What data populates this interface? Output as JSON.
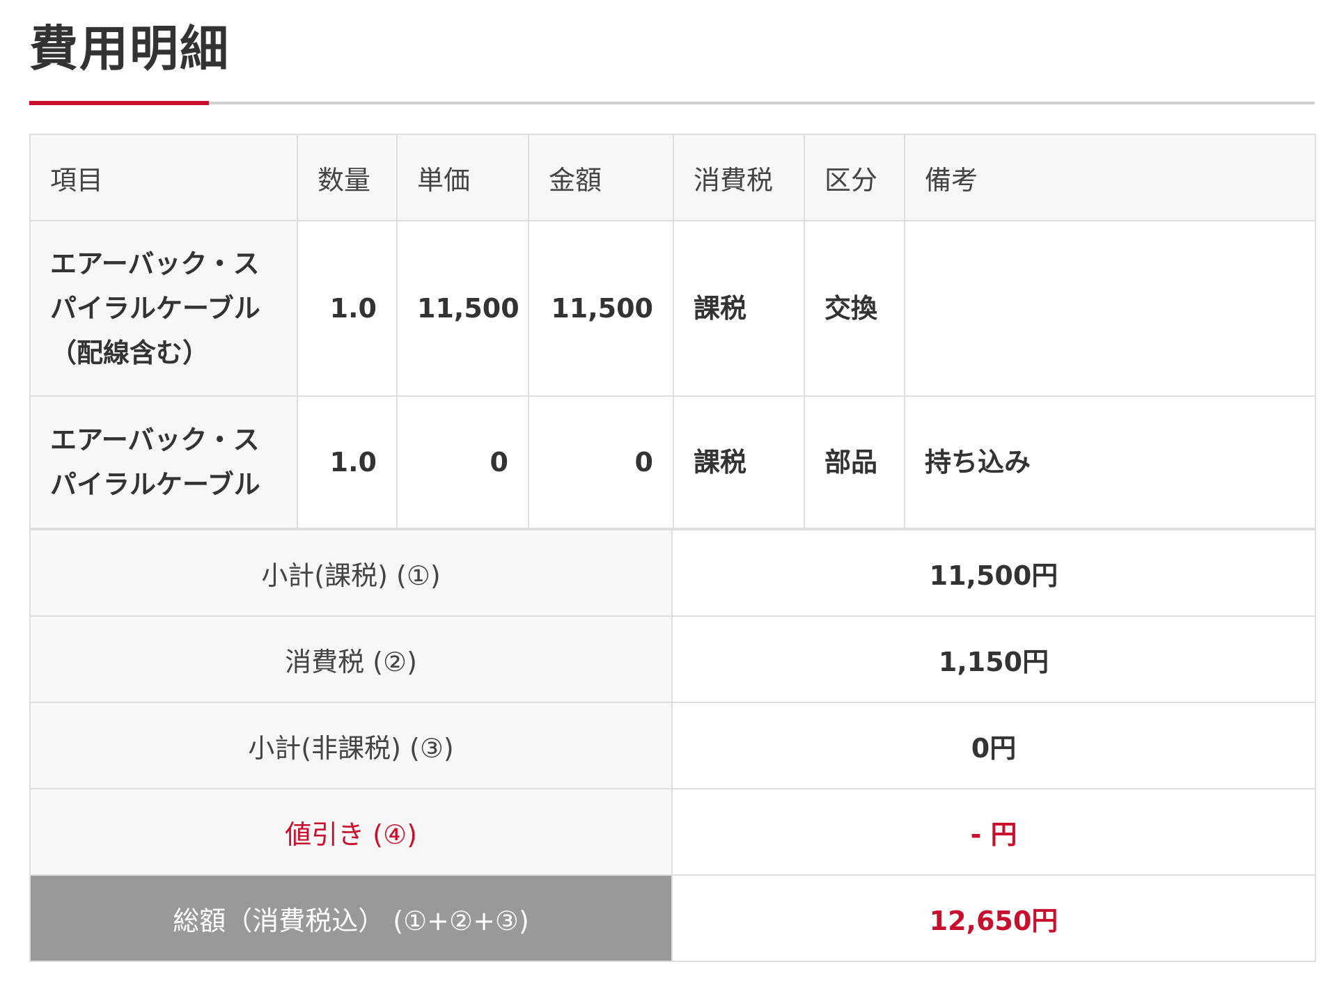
{
  "title": "費用明細",
  "colors": {
    "accent": "#c8102e",
    "header_bg": "#f7f7f7",
    "total_bg": "#999999"
  },
  "table": {
    "headers": [
      "項目",
      "数量",
      "単価",
      "金額",
      "消費税",
      "区分",
      "備考"
    ],
    "rows": [
      {
        "item_lines": [
          "エアーバック・ス",
          "パイラルケーブル",
          "（配線含む）"
        ],
        "quantity": "1.0",
        "unit_price": "11,500",
        "amount": "11,500",
        "tax": "課税",
        "category": "交換",
        "note": ""
      },
      {
        "item_lines": [
          "エアーバック・ス",
          "パイラルケーブル"
        ],
        "quantity": "1.0",
        "unit_price": "0",
        "amount": "0",
        "tax": "課税",
        "category": "部品",
        "note": "持ち込み"
      }
    ]
  },
  "summary": {
    "subtotal_taxable": {
      "label": "小計(課税) (①)",
      "value": "11,500円"
    },
    "consumption_tax": {
      "label": "消費税 (②)",
      "value": "1,150円"
    },
    "subtotal_nontaxable": {
      "label": "小計(非課税) (③)",
      "value": "0円"
    },
    "discount": {
      "label": "値引き (④)",
      "value": "- 円"
    },
    "total": {
      "label": "総額（消費税込） (①+②+③)",
      "value": "12,650円"
    }
  }
}
